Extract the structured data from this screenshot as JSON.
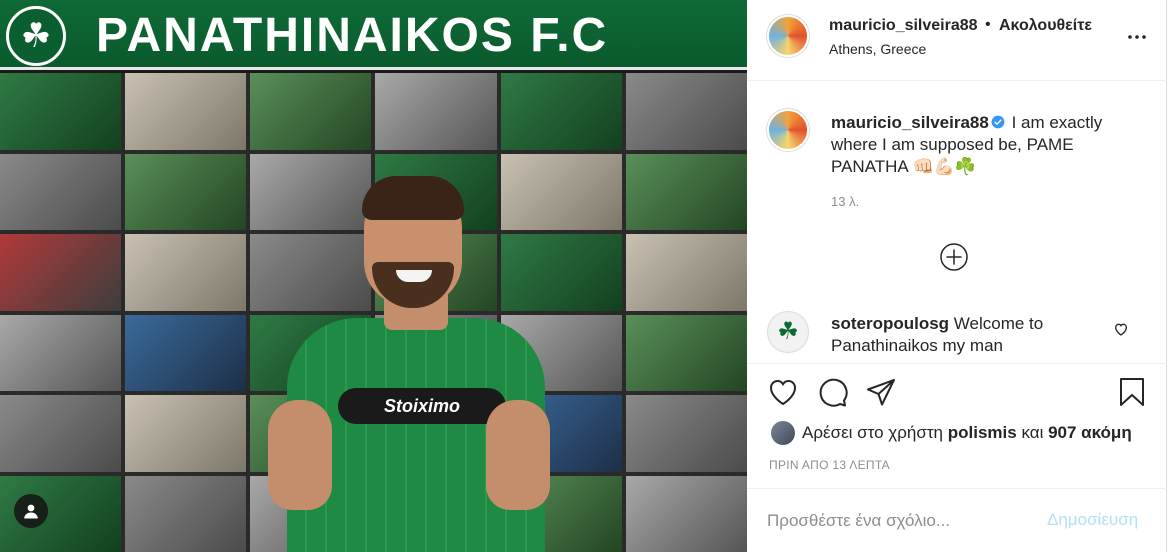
{
  "photo": {
    "banner_text": "PANATHINAIKOS F.C",
    "sponsor_text": "Stoiximo"
  },
  "header": {
    "username": "mauricio_silveira88",
    "separator": "•",
    "follow_label": "Ακολουθείτε",
    "location": "Athens, Greece",
    "more_icon": "more-horizontal-icon"
  },
  "caption": {
    "username": "mauricio_silveira88",
    "text": "I am exactly where I am supposed be, PAME PANATHA 👊🏻💪🏻☘️",
    "time": "13 λ."
  },
  "comments": [
    {
      "username": "soteropoulosg",
      "text": "Welcome to Panathinaikos my man"
    }
  ],
  "likes": {
    "prefix": "Αρέσει στο χρήστη",
    "user": "polismis",
    "conjunction": "και",
    "count_text": "907 ακόμη"
  },
  "post_time": "ΠΡΙΝ ΑΠΟ 13 ΛΕΠΤΑ",
  "add_comment": {
    "placeholder": "Προσθέστε ένα σχόλιο...",
    "post_label": "Δημοσίευση"
  },
  "colors": {
    "link_blue_disabled": "#b2dffc",
    "verified_blue": "#3897f0",
    "club_green": "#0f6a37"
  }
}
